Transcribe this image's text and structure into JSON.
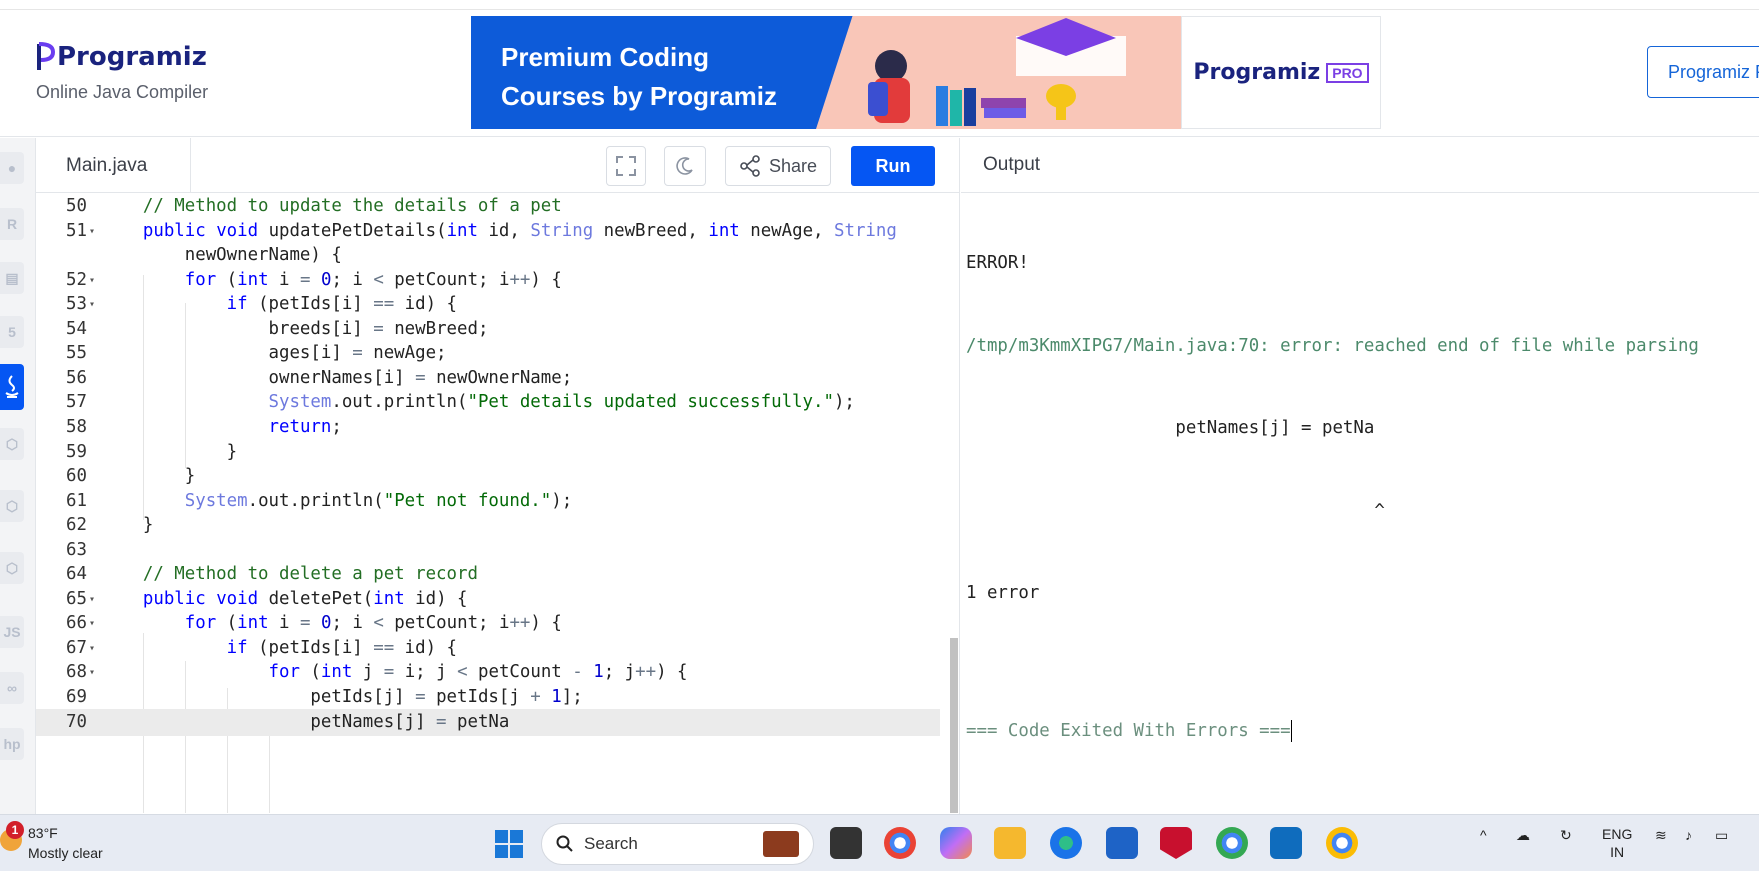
{
  "brand": {
    "name": "Programiz",
    "subtitle": "Online Java Compiler"
  },
  "banner": {
    "line1": "Premium Coding",
    "line2": "Courses by Programiz",
    "pro_logo": "Programiz",
    "pro_badge": "PRO"
  },
  "header_button": "Programiz PRO",
  "editor": {
    "file_tab": "Main.java",
    "share_label": "Share",
    "run_label": "Run"
  },
  "output": {
    "title": "Output",
    "lines": [
      "ERROR!",
      "/tmp/m3KmmXIPG7/Main.java:70: error: reached end of file while parsing",
      "                    petNames[j] = petNa",
      "                                       ^",
      "1 error",
      "",
      "=== Code Exited With Errors ==="
    ]
  },
  "code_lines": [
    {
      "n": "50",
      "text": "    // Method to update the details of a pet"
    },
    {
      "n": "51",
      "text": "    public void updatePetDetails(int id, String newBreed, int newAge, String"
    },
    {
      "n": "",
      "text": "        newOwnerName) {"
    },
    {
      "n": "52",
      "text": "        for (int i = 0; i < petCount; i++) {"
    },
    {
      "n": "53",
      "text": "            if (petIds[i] == id) {"
    },
    {
      "n": "54",
      "text": "                breeds[i] = newBreed;"
    },
    {
      "n": "55",
      "text": "                ages[i] = newAge;"
    },
    {
      "n": "56",
      "text": "                ownerNames[i] = newOwnerName;"
    },
    {
      "n": "57",
      "text": "                System.out.println(\"Pet details updated successfully.\");"
    },
    {
      "n": "58",
      "text": "                return;"
    },
    {
      "n": "59",
      "text": "            }"
    },
    {
      "n": "60",
      "text": "        }"
    },
    {
      "n": "61",
      "text": "        System.out.println(\"Pet not found.\");"
    },
    {
      "n": "62",
      "text": "    }"
    },
    {
      "n": "63",
      "text": ""
    },
    {
      "n": "64",
      "text": "    // Method to delete a pet record"
    },
    {
      "n": "65",
      "text": "    public void deletePet(int id) {"
    },
    {
      "n": "66",
      "text": "        for (int i = 0; i < petCount; i++) {"
    },
    {
      "n": "67",
      "text": "            if (petIds[i] == id) {"
    },
    {
      "n": "68",
      "text": "                for (int j = i; j < petCount - 1; j++) {"
    },
    {
      "n": "69",
      "text": "                    petIds[j] = petIds[j + 1];"
    },
    {
      "n": "70",
      "text": "                    petNames[j] = petNa"
    }
  ],
  "folds": [
    "51",
    "52",
    "53",
    "65",
    "66",
    "67",
    "68"
  ],
  "current_line": "70",
  "taskbar": {
    "weather_temp": "83°F",
    "weather_desc": "Mostly clear",
    "notification_count": "1",
    "search_placeholder": "Search",
    "lang_line1": "ENG",
    "lang_line2": "IN"
  }
}
